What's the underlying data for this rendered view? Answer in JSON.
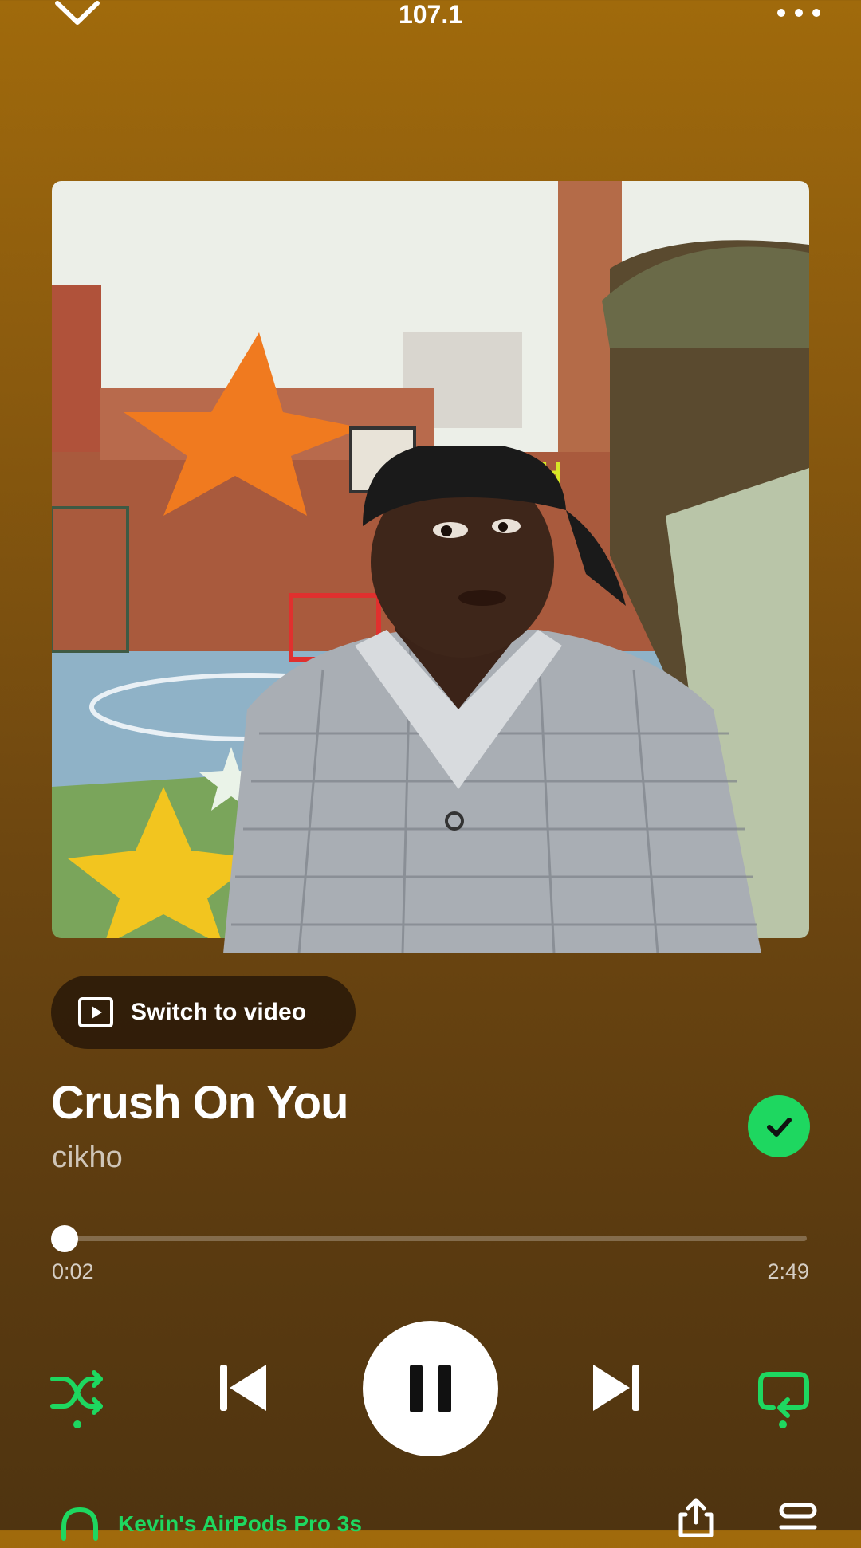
{
  "header": {
    "collapse_icon": "chevron-down-icon",
    "station": "107.1",
    "more_icon": "more-dots-icon"
  },
  "switch_video": {
    "icon": "video-play-icon",
    "label": "Switch to video"
  },
  "track": {
    "title": "Crush On You",
    "artist": "cikho",
    "liked_icon": "check-icon"
  },
  "playback": {
    "elapsed": "0:02",
    "total": "2:49",
    "progress": 0.012
  },
  "controls": {
    "shuffle_icon": "shuffle-icon",
    "prev_icon": "skip-back-icon",
    "play_icon": "pause-icon",
    "next_icon": "skip-forward-icon",
    "repeat_icon": "repeat-icon"
  },
  "device": {
    "icon": "headphones-icon",
    "name": "Kevin's AirPods Pro 3s"
  },
  "bottom_actions": {
    "share_icon": "share-icon",
    "queue_icon": "queue-icon"
  },
  "colors": {
    "accent": "#1ed760",
    "background_top": "#a06a0c",
    "background_bottom": "#4f3410"
  }
}
